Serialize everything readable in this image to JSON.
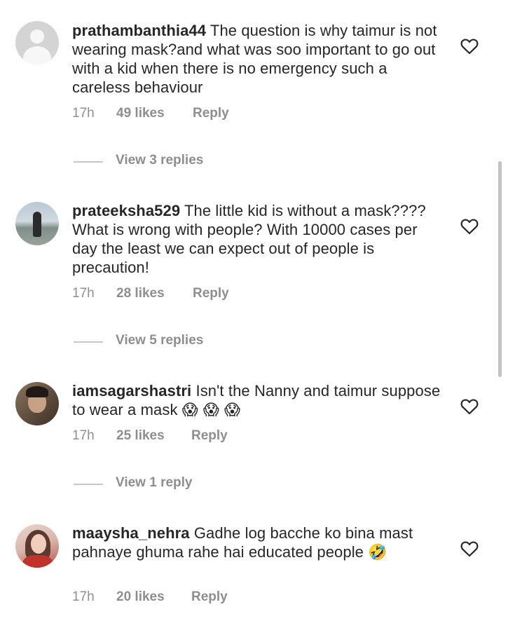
{
  "comments": [
    {
      "username": "prathambanthia44",
      "text": "The question is why taimur is not wearing mask?and what was soo important to go out with a kid  when there is no emergency such a careless behaviour",
      "time": "17h",
      "likes": "49 likes",
      "reply_label": "Reply",
      "view_replies": "View 3 replies",
      "avatar": "default-avatar-icon"
    },
    {
      "username": "prateeksha529",
      "text": "The little kid is without a mask???? What is wrong with people? With 10000 cases per day the least we can expect out of people is precaution!",
      "time": "17h",
      "likes": "28 likes",
      "reply_label": "Reply",
      "view_replies": "View 5 replies",
      "avatar": "profile-photo"
    },
    {
      "username": "iamsagarshastri",
      "text": "Isn't the Nanny and taimur suppose to  wear  a mask",
      "emoji": "😱 😱 😱",
      "time": "17h",
      "likes": "25 likes",
      "reply_label": "Reply",
      "view_replies": "View 1 reply",
      "avatar": "profile-photo"
    },
    {
      "username": "maaysha_nehra",
      "text": "Gadhe  log bacche ko bina mast pahnaye ghuma rahe hai educated people",
      "emoji": "🤣",
      "time": "17h",
      "likes": "20 likes",
      "reply_label": "Reply",
      "avatar": "profile-photo"
    }
  ],
  "icons": {
    "like": "heart-outline-icon"
  },
  "colors": {
    "text": "#262626",
    "secondary": "#8e8e8e",
    "divider": "#c7c7c7"
  }
}
